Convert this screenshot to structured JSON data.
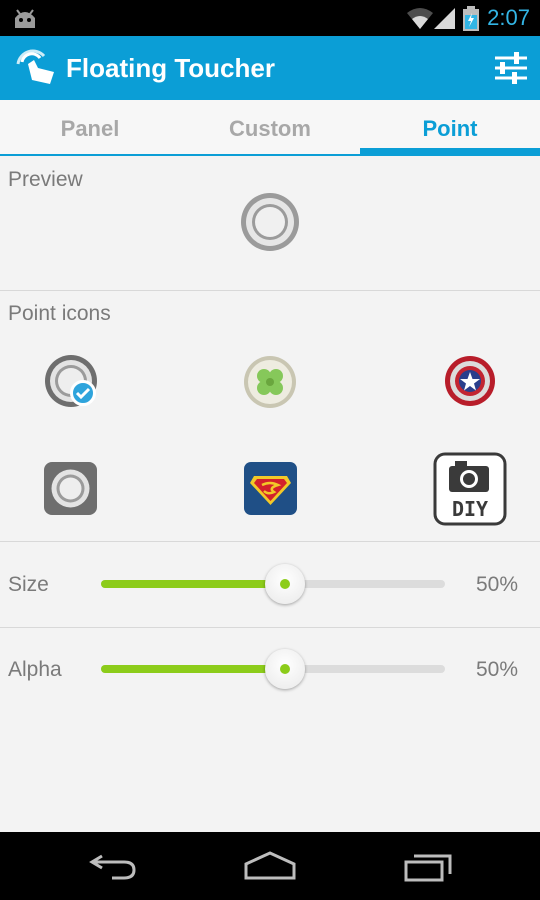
{
  "status_bar": {
    "time": "2:07"
  },
  "app_bar": {
    "title": "Floating Toucher"
  },
  "tabs": [
    {
      "label": "Panel",
      "selected": false
    },
    {
      "label": "Custom",
      "selected": false
    },
    {
      "label": "Point",
      "selected": true
    }
  ],
  "preview": {
    "label": "Preview"
  },
  "point_icons": {
    "label": "Point icons",
    "items": [
      {
        "icon": "gray-ring-icon",
        "selected": true
      },
      {
        "icon": "clover-icon",
        "selected": false
      },
      {
        "icon": "shield-icon",
        "selected": false
      },
      {
        "icon": "gray-square-ring-icon",
        "selected": false
      },
      {
        "icon": "superman-logo-icon",
        "selected": false
      },
      {
        "icon": "diy-camera-icon",
        "label": "DIY",
        "selected": false
      }
    ]
  },
  "size": {
    "label": "Size",
    "value_text": "50%",
    "value": 0.5
  },
  "alpha": {
    "label": "Alpha",
    "value_text": "50%",
    "value": 0.5
  },
  "colors": {
    "accent": "#0b9ed6",
    "slider": "#8ccc1a",
    "clock": "#33b5e5"
  }
}
